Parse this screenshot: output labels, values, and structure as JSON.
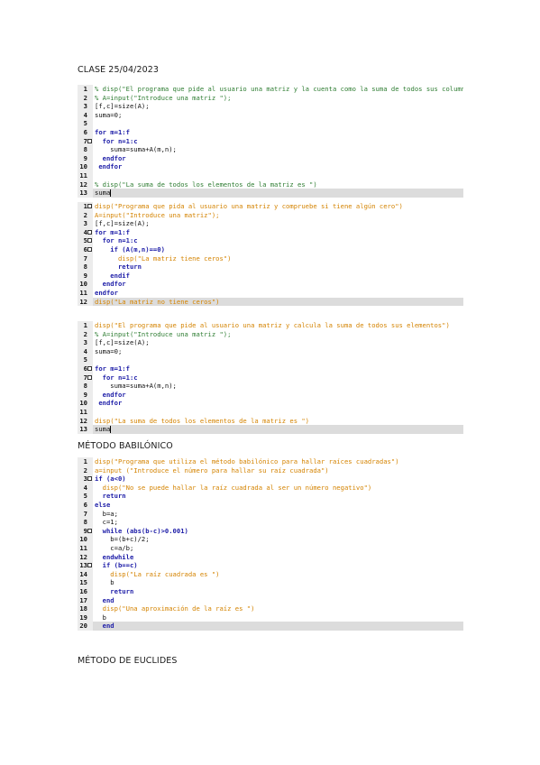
{
  "headings": {
    "clase": "CLASE 25/04/2023",
    "babilonico": "MÉTODO BABILÓNICO",
    "euclides": "MÉTODO DE EUCLIDES"
  },
  "blocks": [
    {
      "lines": [
        {
          "n": "1",
          "t": "% disp(\"El programa que pide al usuario una matriz y la cuenta como la suma de todos sus columnas (par)\")",
          "cls": "c"
        },
        {
          "n": "2",
          "t": "% A=input(\"Introduce una matriz \");",
          "cls": "c"
        },
        {
          "n": "3",
          "t": "[f,c]=size(A);",
          "cls": "p"
        },
        {
          "n": "4",
          "t": "suma=0;",
          "cls": "p"
        },
        {
          "n": "5",
          "t": "",
          "cls": "p"
        },
        {
          "n": "6",
          "t": "for m=1:f",
          "cls": "k"
        },
        {
          "n": "7",
          "t": "  for n=1:c",
          "cls": "k",
          "fold": true
        },
        {
          "n": "8",
          "t": "    suma=suma+A(m,n);",
          "cls": "p"
        },
        {
          "n": "9",
          "t": "  endfor",
          "cls": "k"
        },
        {
          "n": "10",
          "t": " endfor",
          "cls": "k"
        },
        {
          "n": "11",
          "t": "",
          "cls": "p"
        },
        {
          "n": "12",
          "t": "% disp(\"La suma de todos los elementos de la matriz es \")",
          "cls": "c"
        },
        {
          "n": "13",
          "t": "suma",
          "cls": "p",
          "hl": true,
          "cursor": true
        }
      ]
    },
    {
      "lines": [
        {
          "n": "1",
          "t": "disp(\"Programa que pida al usuario una matriz y compruebe si tiene algún cero\")",
          "cls": "s",
          "fold": true
        },
        {
          "n": "2",
          "t": "A=input(\"Introduce una matriz\");",
          "cls": "s"
        },
        {
          "n": "3",
          "t": "[f,c]=size(A);",
          "cls": "p"
        },
        {
          "n": "4",
          "t": "for m=1:f",
          "cls": "k",
          "fold": true
        },
        {
          "n": "5",
          "t": "  for n=1:c",
          "cls": "k",
          "fold": true
        },
        {
          "n": "6",
          "t": "    if (A(m,n)==0)",
          "cls": "k",
          "fold": true
        },
        {
          "n": "7",
          "t": "      disp(\"La matriz tiene ceros\")",
          "cls": "s"
        },
        {
          "n": "8",
          "t": "      return",
          "cls": "k"
        },
        {
          "n": "9",
          "t": "    endif",
          "cls": "k"
        },
        {
          "n": "10",
          "t": "  endfor",
          "cls": "k"
        },
        {
          "n": "11",
          "t": "endfor",
          "cls": "k"
        },
        {
          "n": "12",
          "t": "disp(\"La matriz no tiene ceros\")",
          "cls": "s",
          "hl": true
        }
      ]
    },
    {
      "lines": [
        {
          "n": "1",
          "t": "disp(\"El programa que pide al usuario una matriz y calcula la suma de todos sus elementos\")",
          "cls": "s"
        },
        {
          "n": "2",
          "t": "% A=input(\"Introduce una matriz \");",
          "cls": "c"
        },
        {
          "n": "3",
          "t": "[f,c]=size(A);",
          "cls": "p"
        },
        {
          "n": "4",
          "t": "suma=0;",
          "cls": "p"
        },
        {
          "n": "5",
          "t": "",
          "cls": "p"
        },
        {
          "n": "6",
          "t": "for m=1:f",
          "cls": "k",
          "fold": true
        },
        {
          "n": "7",
          "t": "  for n=1:c",
          "cls": "k",
          "fold": true
        },
        {
          "n": "8",
          "t": "    suma=suma+A(m,n);",
          "cls": "p"
        },
        {
          "n": "9",
          "t": "  endfor",
          "cls": "k"
        },
        {
          "n": "10",
          "t": " endfor",
          "cls": "k"
        },
        {
          "n": "11",
          "t": "",
          "cls": "p"
        },
        {
          "n": "12",
          "t": "disp(\"La suma de todos los elementos de la matriz es \")",
          "cls": "s"
        },
        {
          "n": "13",
          "t": "suma",
          "cls": "p",
          "hl": true,
          "cursor": true
        }
      ]
    },
    {
      "lines": [
        {
          "n": "1",
          "t": "disp(\"Programa que utiliza el método babilónico para hallar raíces cuadradas\")",
          "cls": "s"
        },
        {
          "n": "2",
          "t": "a=input (\"Introduce el número para hallar su raíz cuadrada\")",
          "cls": "s"
        },
        {
          "n": "3",
          "t": "if (a<0)",
          "cls": "k",
          "fold": true
        },
        {
          "n": "4",
          "t": "  disp(\"No se puede hallar la raíz cuadrada al ser un número negativo\")",
          "cls": "s"
        },
        {
          "n": "5",
          "t": "  return",
          "cls": "k"
        },
        {
          "n": "6",
          "t": "else",
          "cls": "k"
        },
        {
          "n": "7",
          "t": "  b=a;",
          "cls": "p"
        },
        {
          "n": "8",
          "t": "  c=1;",
          "cls": "p"
        },
        {
          "n": "9",
          "t": "  while (abs(b-c)>0.001)",
          "cls": "k",
          "fold": true
        },
        {
          "n": "10",
          "t": "    b=(b+c)/2;",
          "cls": "p"
        },
        {
          "n": "11",
          "t": "    c=a/b;",
          "cls": "p"
        },
        {
          "n": "12",
          "t": "  endwhile",
          "cls": "k"
        },
        {
          "n": "13",
          "t": "  if (b==c)",
          "cls": "k",
          "fold": true
        },
        {
          "n": "14",
          "t": "    disp(\"La raíz cuadrada es \")",
          "cls": "s"
        },
        {
          "n": "15",
          "t": "    b",
          "cls": "p"
        },
        {
          "n": "16",
          "t": "    return",
          "cls": "k"
        },
        {
          "n": "17",
          "t": "  end",
          "cls": "k"
        },
        {
          "n": "18",
          "t": "  disp(\"Una aproximación de la raíz es \")",
          "cls": "s"
        },
        {
          "n": "19",
          "t": "  b",
          "cls": "p"
        },
        {
          "n": "20",
          "t": "  end",
          "cls": "k",
          "hl": true
        }
      ]
    }
  ]
}
